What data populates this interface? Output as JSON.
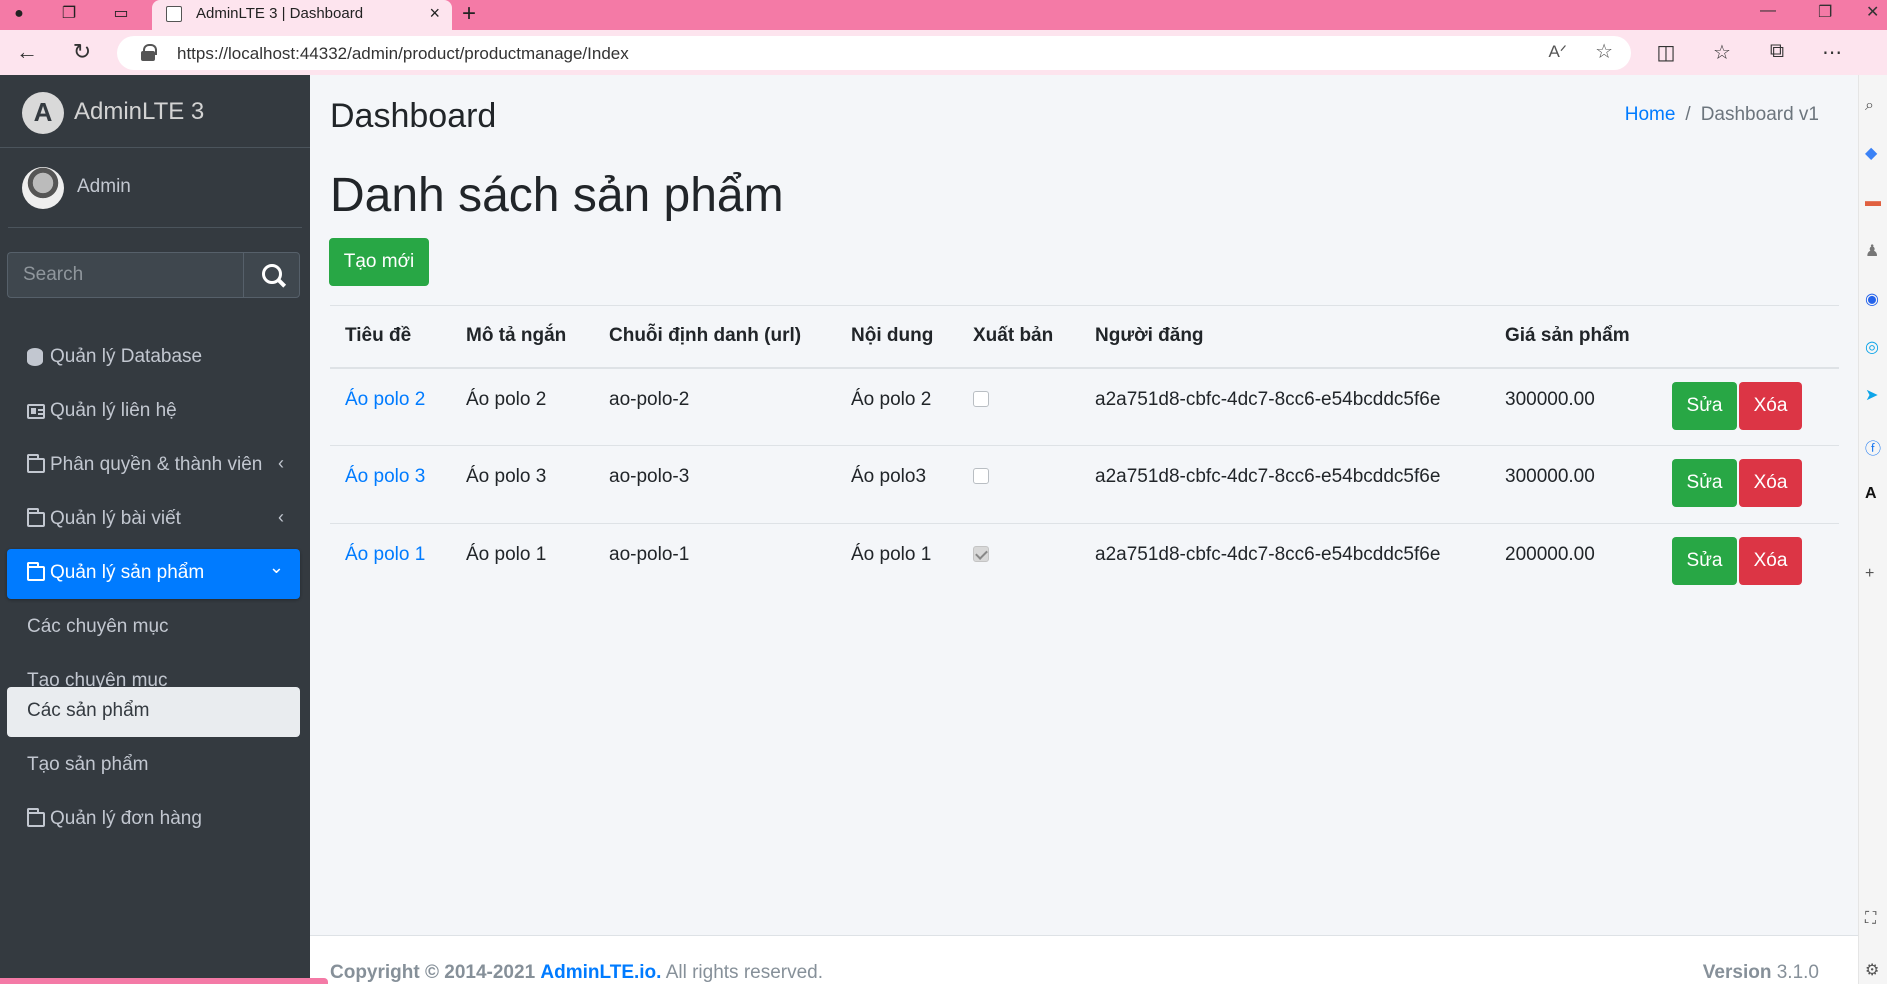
{
  "browser": {
    "tab_title": "AdminLTE 3 | Dashboard",
    "url": "https://localhost:44332/admin/product/productmanage/Index"
  },
  "sidebar": {
    "brand": "AdminLTE 3",
    "user": "Admin",
    "search_placeholder": "Search",
    "items": [
      {
        "label": "Quản lý Database",
        "icon": "database-icon"
      },
      {
        "label": "Quản lý liên hệ",
        "icon": "id-card-icon"
      },
      {
        "label": "Phân quyền & thành viên",
        "icon": "folder-icon",
        "chevron": "‹"
      },
      {
        "label": "Quản lý bài viết",
        "icon": "folder-icon",
        "chevron": "‹"
      },
      {
        "label": "Quản lý sản phẩm",
        "icon": "folder-icon",
        "chevron": "⌄"
      },
      {
        "label": "Các chuyên mục"
      },
      {
        "label": "Tạo chuyên mục"
      },
      {
        "label": "Các sản phẩm"
      },
      {
        "label": "Tạo sản phẩm"
      },
      {
        "label": "Quản lý đơn hàng",
        "icon": "folder-icon"
      }
    ]
  },
  "header": {
    "title": "Dashboard",
    "breadcrumb_home": "Home",
    "breadcrumb_sep": "/",
    "breadcrumb_current": "Dashboard v1"
  },
  "main": {
    "page_title": "Danh sách sản phẩm",
    "create_button": "Tạo mới",
    "columns": [
      "Tiêu đề",
      "Mô tả ngắn",
      "Chuỗi định danh (url)",
      "Nội dung",
      "Xuất bản",
      "Người đăng",
      "Giá sản phẩm"
    ],
    "rows": [
      {
        "title": "Áo polo 2",
        "short": "Áo polo 2",
        "slug": "ao-polo-2",
        "content": "Áo polo 2",
        "published": false,
        "author": "a2a751d8-cbfc-4dc7-8cc6-e54bcddc5f6e",
        "price": "300000.00"
      },
      {
        "title": "Áo polo 3",
        "short": "Áo polo 3",
        "slug": "ao-polo-3",
        "content": "Áo polo3",
        "published": false,
        "author": "a2a751d8-cbfc-4dc7-8cc6-e54bcddc5f6e",
        "price": "300000.00"
      },
      {
        "title": "Áo polo 1",
        "short": "Áo polo 1",
        "slug": "ao-polo-1",
        "content": "Áo polo 1",
        "published": true,
        "author": "a2a751d8-cbfc-4dc7-8cc6-e54bcddc5f6e",
        "price": "200000.00"
      }
    ],
    "edit_label": "Sửa",
    "delete_label": "Xóa"
  },
  "footer": {
    "copyright": "Copyright © 2014-2021",
    "brand_link": "AdminLTE.io.",
    "rights": "All rights reserved.",
    "version_label": "Version",
    "version": "3.1.0"
  }
}
